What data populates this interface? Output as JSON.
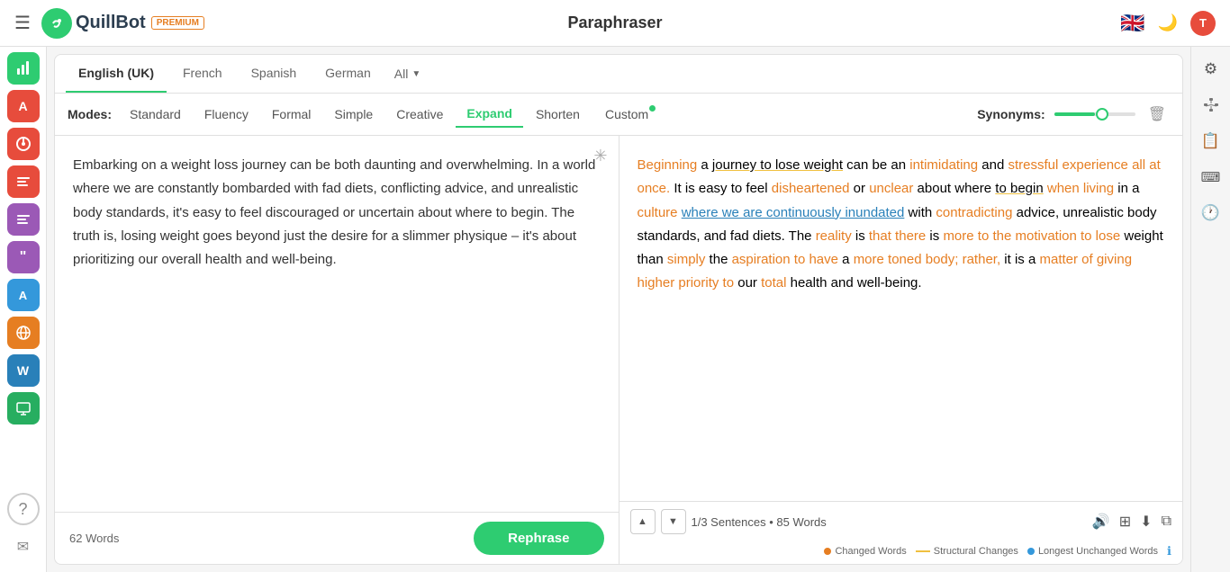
{
  "header": {
    "menu_icon": "☰",
    "logo_letter": "Q",
    "logo_name": "QuillBot",
    "premium_label": "PREMIUM",
    "title": "Paraphraser",
    "flag_emoji": "🇬🇧",
    "theme_icon": "🌙",
    "user_initial": "T"
  },
  "language_tabs": [
    {
      "label": "English (UK)",
      "active": true
    },
    {
      "label": "French",
      "active": false
    },
    {
      "label": "Spanish",
      "active": false
    },
    {
      "label": "German",
      "active": false
    },
    {
      "label": "All",
      "active": false,
      "has_dropdown": true
    }
  ],
  "modes": {
    "label": "Modes:",
    "items": [
      {
        "label": "Standard",
        "active": false
      },
      {
        "label": "Fluency",
        "active": false
      },
      {
        "label": "Formal",
        "active": false
      },
      {
        "label": "Simple",
        "active": false
      },
      {
        "label": "Creative",
        "active": false
      },
      {
        "label": "Expand",
        "active": true
      },
      {
        "label": "Shorten",
        "active": false
      },
      {
        "label": "Custom",
        "active": false,
        "has_dot": true
      }
    ],
    "synonyms_label": "Synonyms:",
    "delete_icon": "🗑"
  },
  "left_panel": {
    "text": "Embarking on a weight loss journey can be both daunting and overwhelming. In a world where we are constantly bombarded with fad diets, conflicting advice, and unrealistic body standards, it's easy to feel discouraged or uncertain about where to begin. The truth is, losing weight goes beyond just the desire for a slimmer physique – it's about prioritizing our overall health and well-being.",
    "word_count": "62 Words",
    "rephrase_label": "Rephrase"
  },
  "right_panel": {
    "sentence_nav": "1/3 Sentences • 85 Words",
    "nav_up": "▲",
    "nav_down": "▼",
    "speaker_icon": "🔊",
    "table_icon": "⊞",
    "download_icon": "⬇",
    "copy_icon": "⧉"
  },
  "legend": {
    "changed_label": "Changed Words",
    "structural_label": "Structural Changes",
    "unchanged_label": "Longest Unchanged Words",
    "changed_color": "#e67e22",
    "structural_color": "#f1c40f",
    "unchanged_color": "#3498db"
  },
  "sidebar_right_icons": [
    "⚙",
    "👥",
    "📋",
    "⌨",
    "🕐"
  ],
  "sidebar_left_apps": [
    "📊",
    "A",
    "🔴",
    "✏",
    "≡",
    "❝",
    "A",
    "🌐",
    "W",
    "🖥"
  ]
}
